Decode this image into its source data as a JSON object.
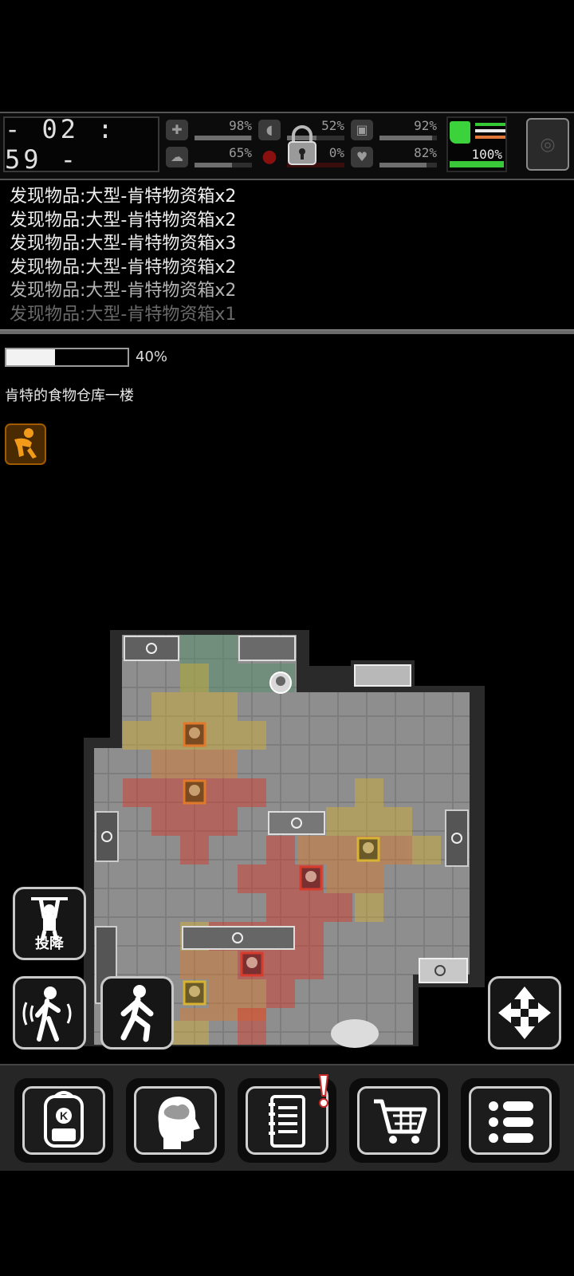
{
  "hud": {
    "clock": "- 02 : 59 -",
    "stats": [
      {
        "name": "health",
        "icon": "medkit-icon",
        "value": "98%",
        "fill": 0.98
      },
      {
        "name": "hunger",
        "icon": "stomach-icon",
        "value": "52%",
        "fill": 0.52
      },
      {
        "name": "thirst",
        "icon": "canteen-icon",
        "value": "92%",
        "fill": 0.92
      },
      {
        "name": "sanity",
        "icon": "brain-icon",
        "value": "65%",
        "fill": 0.65
      },
      {
        "name": "bleeding",
        "icon": "blood-drop-icon",
        "value": "0%",
        "fill": 0.0
      },
      {
        "name": "mood",
        "icon": "heart-icon",
        "value": "82%",
        "fill": 0.82
      }
    ],
    "stamina": {
      "value": "100%",
      "fill": 1.0,
      "colors": [
        "#35c935",
        "#e8e8e8",
        "#e0783a"
      ]
    }
  },
  "log": [
    "发现物品:大型-肯特物资箱x2",
    "发现物品:大型-肯特物资箱x2",
    "发现物品:大型-肯特物资箱x3",
    "发现物品:大型-肯特物资箱x2",
    "发现物品:大型-肯特物资箱x2",
    "发现物品:大型-肯特物资箱x1"
  ],
  "progress": {
    "value": 0.4,
    "label": "40%"
  },
  "location": "肯特的食物仓库一楼",
  "buttons": {
    "surrender": "投降"
  },
  "colors": {
    "danger_red": "#d63c2c",
    "warning_orange": "#e07a2a",
    "caution_yellow": "#d8b232",
    "safe_green": "#5aa872",
    "stamina_green": "#39c739"
  }
}
